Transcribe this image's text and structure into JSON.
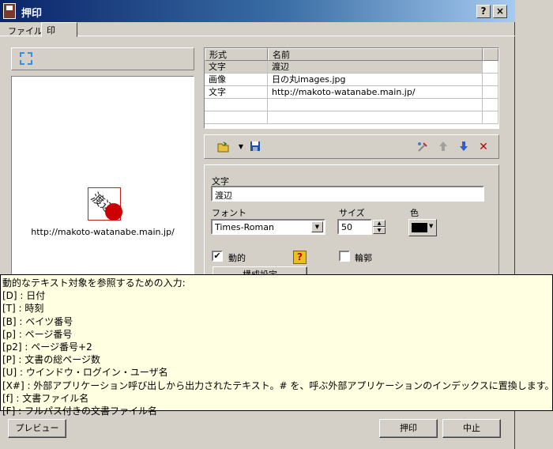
{
  "window": {
    "title": "押印"
  },
  "titlebar_buttons": {
    "help": "?",
    "close": "×"
  },
  "tabs": [
    {
      "label": "ファイル",
      "active": false
    },
    {
      "label": "印",
      "active": true
    }
  ],
  "preview": {
    "stamp_text": "渡辺",
    "url_text": "http://makoto-watanabe.main.jp/"
  },
  "table": {
    "columns": [
      "形式",
      "名前"
    ],
    "rows": [
      {
        "type": "文字",
        "name": "渡辺"
      },
      {
        "type": "画像",
        "name": "日の丸images.jpg"
      },
      {
        "type": "文字",
        "name": "http://makoto-watanabe.main.jp/"
      }
    ]
  },
  "toolbar": {
    "icons": [
      "open-folder-icon",
      "dropdown-arrow-icon",
      "save-icon",
      "tool-icon",
      "up-arrow-icon",
      "down-arrow-icon",
      "delete-icon"
    ]
  },
  "properties": {
    "text_label": "文字",
    "text_value": "渡辺",
    "font_label": "フォント",
    "font_value": "Times-Roman",
    "size_label": "サイズ",
    "size_value": "50",
    "color_label": "色",
    "color_value": "#000000",
    "dynamic_label": "動的",
    "dynamic_checked": true,
    "outline_label": "輪郭",
    "outline_checked": false,
    "config_button": "構成設定"
  },
  "tooltip": {
    "lines": [
      "動的なテキスト対象を参照するための入力:",
      "[D] : 日付",
      "[T] : 時刻",
      "[B] : ベイツ番号",
      "[p] : ページ番号",
      "[p2] : ページ番号+2",
      "[P] : 文書の総ページ数",
      "[U] : ウインドウ・ログイン・ユーザ名",
      "[X#] : 外部アプリケーション呼び出しから出力されたテキスト。# を、呼ぶ外部アプリケーションのインデックスに置換します。",
      "[f] : 文書ファイル名",
      "[F] : フルパス付きの文書ファイル名"
    ]
  },
  "buttons": {
    "preview": "プレビュー",
    "stamp": "押印",
    "cancel": "中止"
  }
}
